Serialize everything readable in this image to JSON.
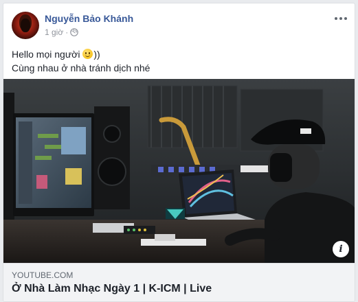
{
  "post": {
    "author": "Nguyễn Bảo Khánh",
    "time": "1 giờ",
    "separator": "·",
    "privacy_icon": "globe-icon",
    "more_icon": "more-horizontal-icon",
    "text_line1": "Hello mọi người ",
    "text_line1_suffix": "))",
    "text_line2": "Cùng nhau ở nhà tránh dịch nhé"
  },
  "link": {
    "domain": "YOUTUBE.COM",
    "title": "Ở Nhà Làm Nhạc Ngày 1 | K-ICM | Live",
    "info_icon_glyph": "i"
  },
  "colors": {
    "author": "#385898",
    "text": "#1d2129",
    "secondary": "#90949c",
    "caption_bg": "#f2f3f5"
  }
}
